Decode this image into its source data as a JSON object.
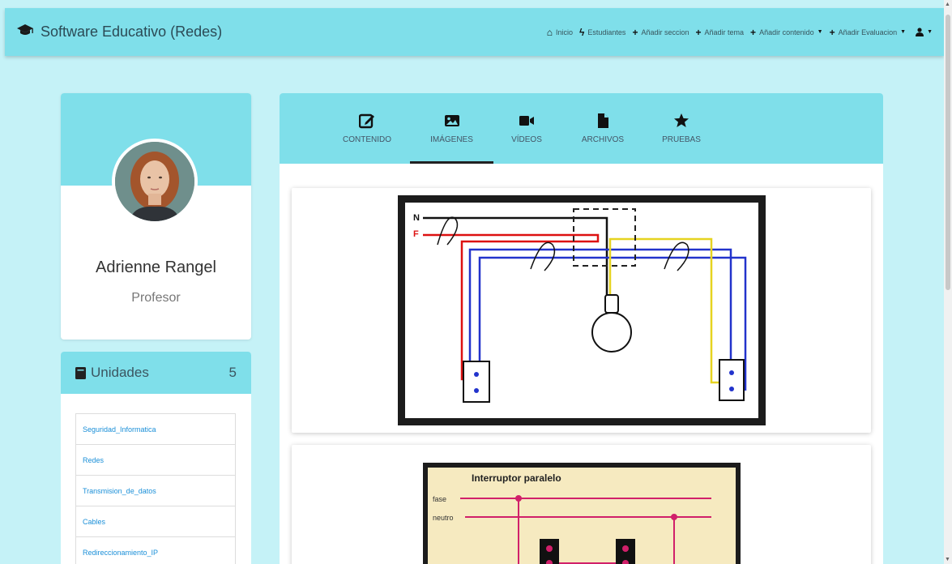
{
  "navbar": {
    "brand": "Software Educativo (Redes)",
    "links": [
      {
        "label": "Inicio",
        "icon": "home-icon"
      },
      {
        "label": "Estudiantes",
        "icon": "bolt-icon"
      },
      {
        "label": "Añadir seccion",
        "icon": "plus-icon"
      },
      {
        "label": "Añadir tema",
        "icon": "plus-icon"
      },
      {
        "label": "Añadir contenido",
        "icon": "plus-icon",
        "dropdown": true
      },
      {
        "label": "Añadir Evaluacion",
        "icon": "plus-icon",
        "dropdown": true
      }
    ]
  },
  "profile": {
    "name": "Adrienne Rangel",
    "role": "Profesor"
  },
  "units": {
    "title": "Unidades",
    "count": "5",
    "items": [
      "Seguridad_Informatica",
      "Redes",
      "Transmision_de_datos",
      "Cables",
      "Redireccionamiento_IP"
    ]
  },
  "tabs": [
    {
      "label": "CONTENIDO",
      "icon": "edit-icon"
    },
    {
      "label": "IMÁGENES",
      "icon": "image-icon",
      "active": true
    },
    {
      "label": "VÍDEOS",
      "icon": "video-icon"
    },
    {
      "label": "ARCHIVOS",
      "icon": "file-icon"
    },
    {
      "label": "PRUEBAS",
      "icon": "star-icon"
    }
  ],
  "images": {
    "diagram1": {
      "label_n": "N",
      "label_f": "F"
    },
    "diagram2": {
      "title": "Interruptor paralelo",
      "label_fase": "fase",
      "label_neutro": "neutro"
    }
  },
  "colors": {
    "accent": "#7fdfea",
    "background": "#c5f2f7",
    "link": "#1a8fd8"
  }
}
